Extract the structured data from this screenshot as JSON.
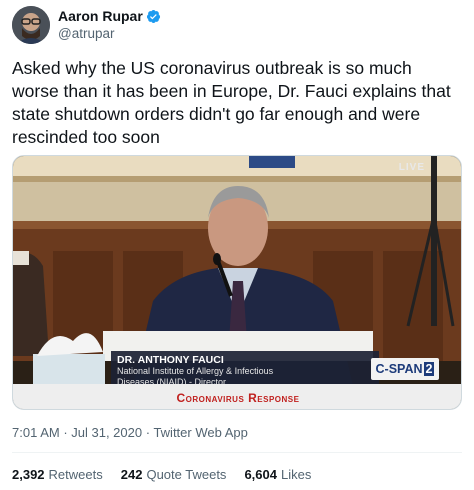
{
  "author": {
    "display_name": "Aaron Rupar",
    "handle": "@atrupar",
    "verified_icon": "verified-badge-icon",
    "avatar": "avatar-photo"
  },
  "tweet": {
    "text": "Asked why the US coronavirus outbreak is so much worse than it has been in Europe, Dr. Fauci explains that state shutdown orders didn't go far enough and were rescinded too soon"
  },
  "media": {
    "live_label": "LIVE",
    "lower_third_name": "DR. ANTHONY FAUCI",
    "lower_third_title_1": "National Institute of Allergy & Infectious",
    "lower_third_title_2": "Diseases (NIAID) - Director",
    "network_logo": "C-SPAN",
    "network_logo_num": "2",
    "banner": "Coronavirus Response"
  },
  "meta": {
    "time": "7:01 AM",
    "sep1": " · ",
    "date": "Jul 31, 2020",
    "sep2": " · ",
    "source": "Twitter Web App"
  },
  "stats": {
    "retweets_count": "2,392",
    "retweets_label": "Retweets",
    "quotes_count": "242",
    "quotes_label": "Quote Tweets",
    "likes_count": "6,604",
    "likes_label": "Likes"
  },
  "colors": {
    "accent": "#1d9bf0",
    "text_primary": "#0f1419",
    "text_secondary": "#536471",
    "banner_red": "#c0201e"
  }
}
